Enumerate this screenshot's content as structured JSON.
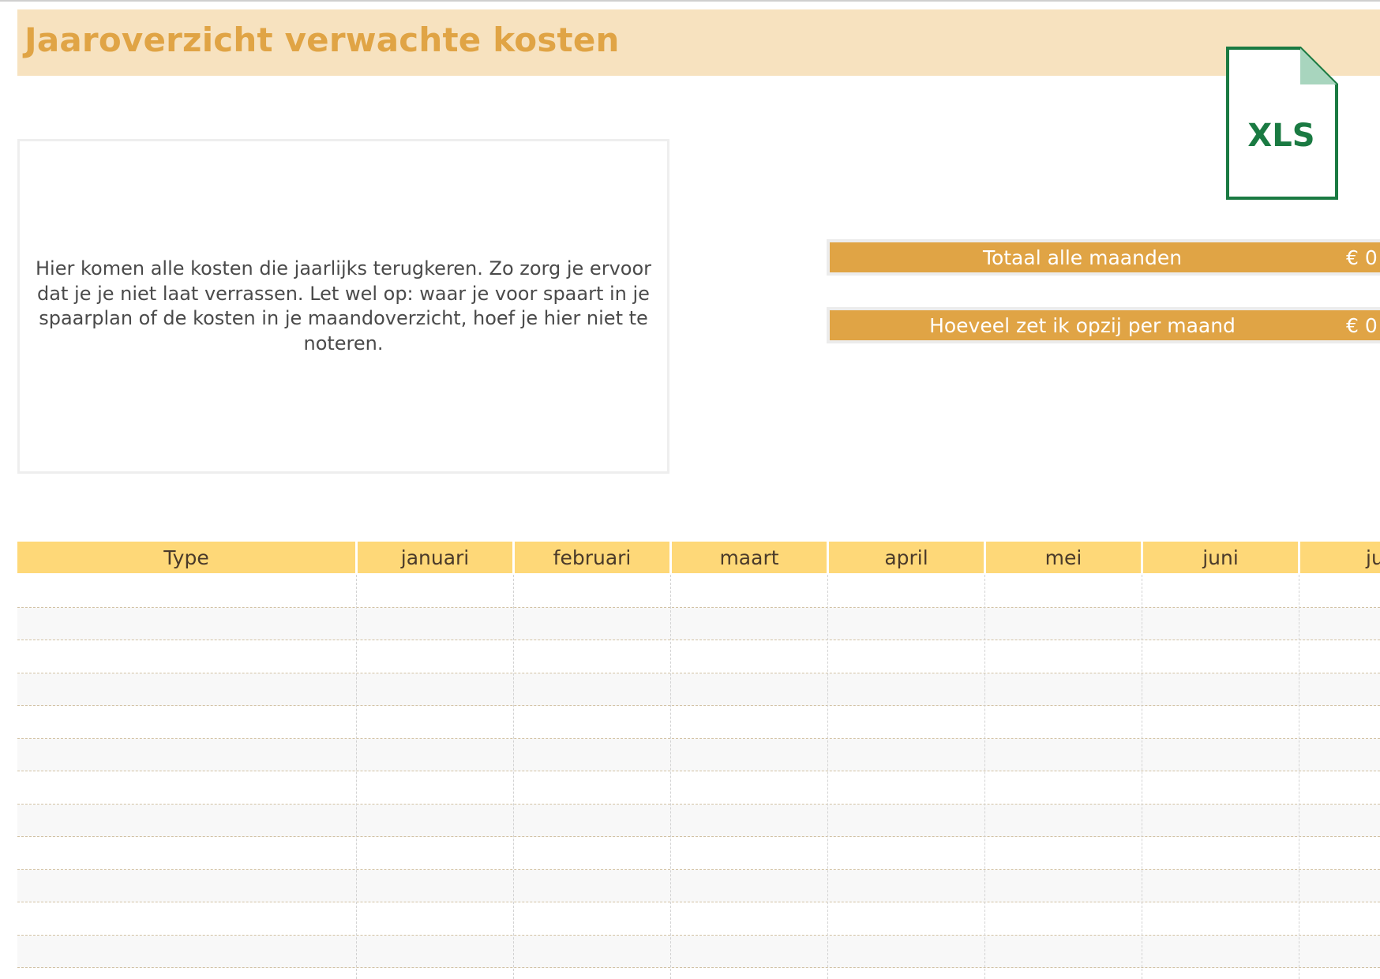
{
  "sheet": {
    "title": "Jaaroverzicht verwachte kosten",
    "info_text": "Hier komen alle kosten die jaarlijks terugkeren.  Zo zorg je ervoor dat je je niet laat verrassen. Let wel op: waar je voor spaart in je spaarplan of de kosten in je maandoverzicht, hoef je hier niet te noteren."
  },
  "xls_icon": {
    "label": "XLS",
    "icon": "xls-file-icon",
    "color": "#1a7a42",
    "corner_color": "#a8d5be"
  },
  "summary": {
    "total_label": "Totaal alle maanden",
    "total_value": "€ 0",
    "monthly_label": "Hoeveel zet ik opzij per maand",
    "monthly_value": "€ 0"
  },
  "table": {
    "headers": [
      "Type",
      "januari",
      "februari",
      "maart",
      "april",
      "mei",
      "juni",
      "ju"
    ],
    "rows": [
      "",
      "",
      "",
      "",
      "",
      "",
      "",
      "",
      "",
      "",
      "",
      ""
    ]
  },
  "colors": {
    "accent": "#e0a445",
    "title_band": "#f7e2bf",
    "header_band": "#fed878"
  }
}
